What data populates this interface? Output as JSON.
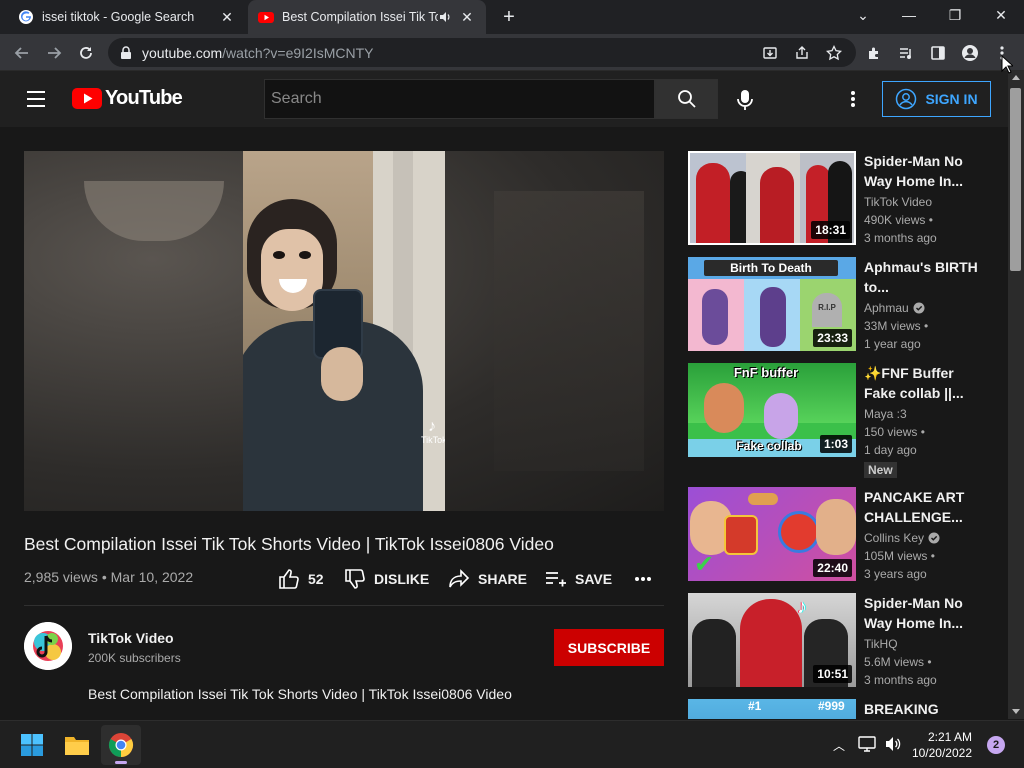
{
  "browser": {
    "tabs": [
      {
        "title": "issei tiktok - Google Search",
        "favicon": "google-icon",
        "active": false
      },
      {
        "title": "Best Compilation Issei Tik Tok Sh",
        "favicon": "youtube-icon",
        "active": true
      }
    ],
    "url_host": "youtube.com",
    "url_path": "/watch?v=e9I2IsMCNTY"
  },
  "youtube": {
    "logo_text": "YouTube",
    "search_placeholder": "Search",
    "sign_in_label": "SIGN IN"
  },
  "video": {
    "title": "Best Compilation Issei Tik Tok Shorts Video | TikTok Issei0806 Video",
    "views": "2,985 views",
    "date": "Mar 10, 2022",
    "likes": "52",
    "dislike_label": "DISLIKE",
    "share_label": "SHARE",
    "save_label": "SAVE",
    "watermark": "TikTok"
  },
  "channel": {
    "name": "TikTok Video",
    "subscribers": "200K subscribers",
    "subscribe_label": "SUBSCRIBE",
    "description": "Best Compilation Issei Tik Tok Shorts Video | TikTok Issei0806 Video"
  },
  "recommendations": [
    {
      "title": "Spider-Man No Way Home In...",
      "channel": "TikTok Video",
      "verified": false,
      "views": "490K views •",
      "age": "3 months ago",
      "duration": "18:31",
      "badge": ""
    },
    {
      "title": "Aphmau's BIRTH to...",
      "channel": "Aphmau",
      "verified": true,
      "views": "33M views •",
      "age": "1 year ago",
      "duration": "23:33",
      "badge": "",
      "thumb_text": "Birth To Death"
    },
    {
      "title": "✨FNF Buffer Fake collab ||...",
      "channel": "Maya :3",
      "verified": false,
      "views": "150 views •",
      "age": "1 day ago",
      "duration": "1:03",
      "badge": "New",
      "thumb_text_top": "FnF buffer",
      "thumb_text_bottom": "Fake collab"
    },
    {
      "title": "PANCAKE ART CHALLENGE...",
      "channel": "Collins Key",
      "verified": true,
      "views": "105M views •",
      "age": "3 years ago",
      "duration": "22:40",
      "badge": ""
    },
    {
      "title": "Spider-Man No Way Home In...",
      "channel": "TikHQ",
      "verified": false,
      "views": "5.6M views •",
      "age": "3 months ago",
      "duration": "10:51",
      "badge": ""
    },
    {
      "title": "BREAKING",
      "thumb_text_left": "#1",
      "thumb_text_right": "#999"
    }
  ],
  "taskbar": {
    "time": "2:21 AM",
    "date": "10/20/2022",
    "notifications": "2"
  },
  "colors": {
    "accent_blue": "#3ea6ff",
    "subscribe_red": "#cc0000",
    "youtube_red": "#ff0000"
  }
}
